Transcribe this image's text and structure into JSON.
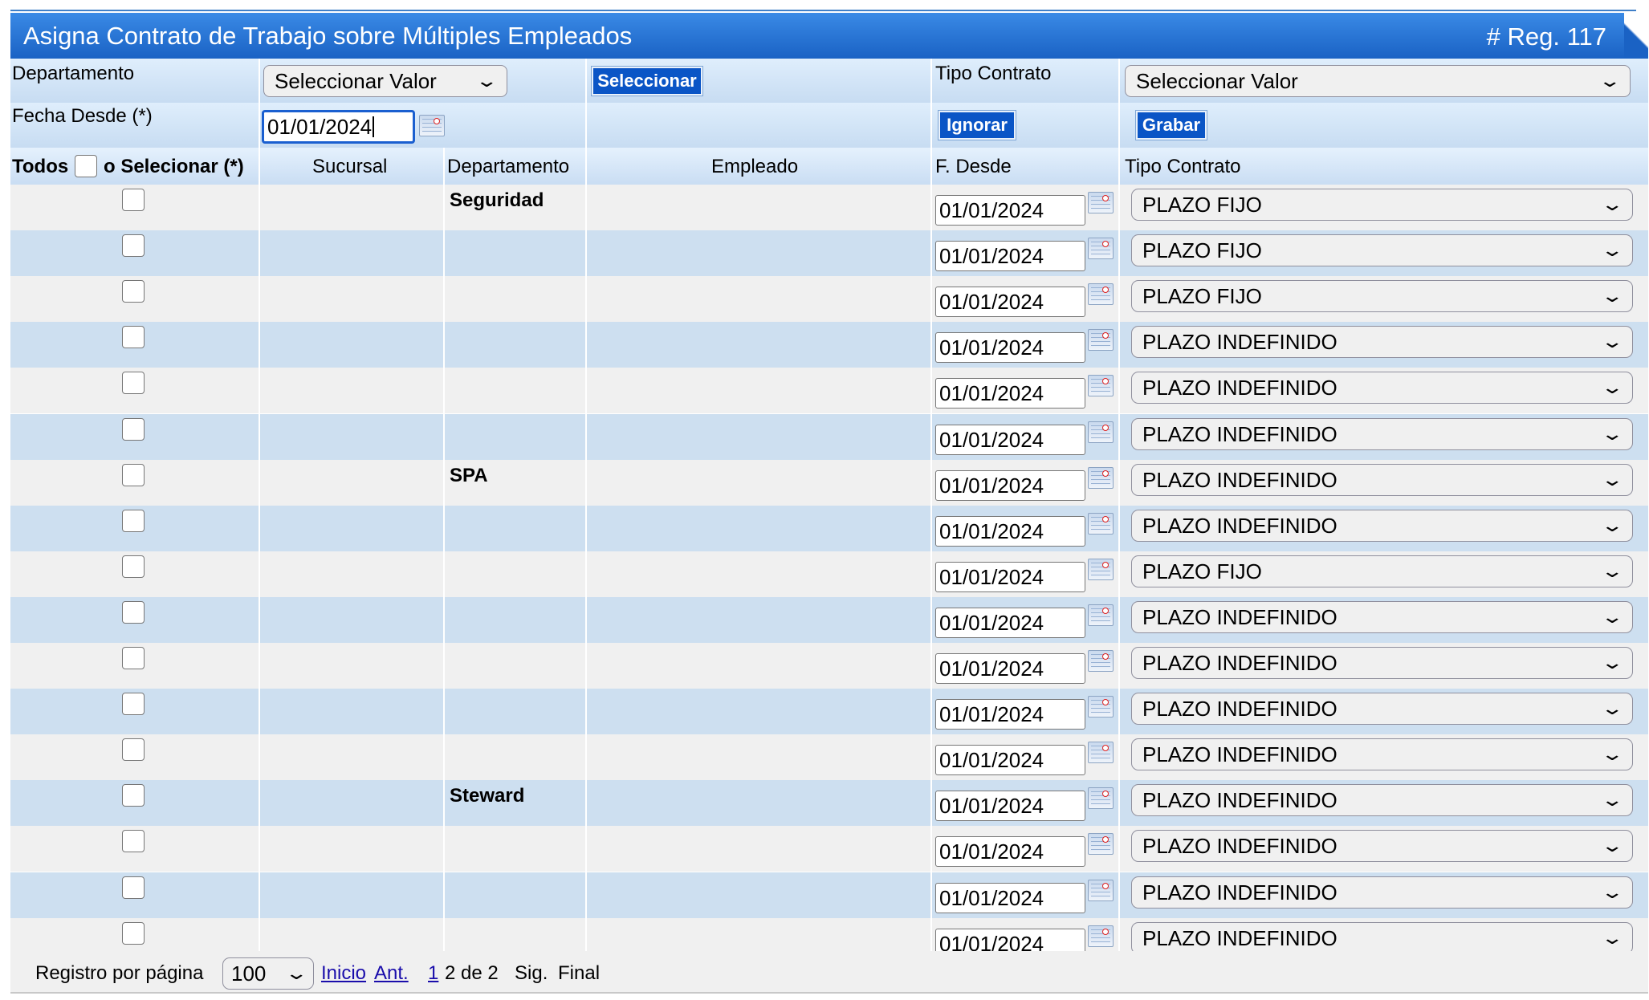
{
  "title": "Asigna Contrato de Trabajo sobre Múltiples Empleados",
  "record_count": "# Reg. 117",
  "filters": {
    "departamento_label": "Departamento",
    "departamento_value": "Seleccionar Valor",
    "seleccionar_button": "Seleccionar",
    "tipo_contrato_label": "Tipo Contrato",
    "tipo_contrato_value": "Seleccionar Valor",
    "fecha_desde_label": "Fecha Desde (*)",
    "fecha_desde_value": "01/01/2024",
    "ignorar_button": "Ignorar",
    "grabar_button": "Grabar"
  },
  "columns": {
    "todos": "Todos",
    "seleccionar": "o Selecionar (*)",
    "sucursal": "Sucursal",
    "departamento": "Departamento",
    "empleado": "Empleado",
    "f_desde": "F. Desde",
    "tipo_contrato": "Tipo Contrato"
  },
  "rows": [
    {
      "departamento": "Seguridad",
      "f_desde": "01/01/2024",
      "tipo_contrato": "PLAZO FIJO"
    },
    {
      "departamento": "",
      "f_desde": "01/01/2024",
      "tipo_contrato": "PLAZO FIJO"
    },
    {
      "departamento": "",
      "f_desde": "01/01/2024",
      "tipo_contrato": "PLAZO FIJO"
    },
    {
      "departamento": "",
      "f_desde": "01/01/2024",
      "tipo_contrato": "PLAZO INDEFINIDO"
    },
    {
      "departamento": "",
      "f_desde": "01/01/2024",
      "tipo_contrato": "PLAZO INDEFINIDO"
    },
    {
      "departamento": "",
      "f_desde": "01/01/2024",
      "tipo_contrato": "PLAZO INDEFINIDO"
    },
    {
      "departamento": "SPA",
      "f_desde": "01/01/2024",
      "tipo_contrato": "PLAZO INDEFINIDO"
    },
    {
      "departamento": "",
      "f_desde": "01/01/2024",
      "tipo_contrato": "PLAZO INDEFINIDO"
    },
    {
      "departamento": "",
      "f_desde": "01/01/2024",
      "tipo_contrato": "PLAZO FIJO"
    },
    {
      "departamento": "",
      "f_desde": "01/01/2024",
      "tipo_contrato": "PLAZO INDEFINIDO"
    },
    {
      "departamento": "",
      "f_desde": "01/01/2024",
      "tipo_contrato": "PLAZO INDEFINIDO"
    },
    {
      "departamento": "",
      "f_desde": "01/01/2024",
      "tipo_contrato": "PLAZO INDEFINIDO"
    },
    {
      "departamento": "",
      "f_desde": "01/01/2024",
      "tipo_contrato": "PLAZO INDEFINIDO"
    },
    {
      "departamento": "Steward",
      "f_desde": "01/01/2024",
      "tipo_contrato": "PLAZO INDEFINIDO"
    },
    {
      "departamento": "",
      "f_desde": "01/01/2024",
      "tipo_contrato": "PLAZO INDEFINIDO"
    },
    {
      "departamento": "",
      "f_desde": "01/01/2024",
      "tipo_contrato": "PLAZO INDEFINIDO"
    },
    {
      "departamento": "",
      "f_desde": "01/01/2024",
      "tipo_contrato": "PLAZO INDEFINIDO"
    }
  ],
  "pagination": {
    "per_page_label": "Registro por página",
    "per_page_value": "100",
    "inicio": "Inicio",
    "ant": "Ant.",
    "page_link": "1",
    "page_info": "2 de 2",
    "sig": "Sig.",
    "final": "Final"
  }
}
